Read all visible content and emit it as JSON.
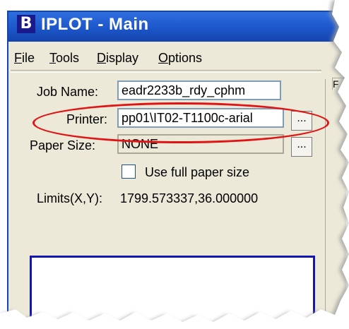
{
  "window": {
    "title": "IPLOT - Main",
    "app_icon": "bentley-b-icon"
  },
  "menu": [
    {
      "label": "File",
      "accel": "F",
      "rest": "ile"
    },
    {
      "label": "Tools",
      "accel": "T",
      "rest": "ools"
    },
    {
      "label": "Display",
      "accel": "D",
      "rest": "isplay"
    },
    {
      "label": "Options",
      "accel": "O",
      "rest": "ptions"
    }
  ],
  "form": {
    "job_name_label": "Job Name:",
    "job_name_value": "eadr2233b_rdy_cphm",
    "printer_label": "Printer:",
    "printer_value": "pp01\\IT02-T1100c-arial",
    "printer_browse": "...",
    "paper_size_label": "Paper Size:",
    "paper_size_value": "NONE",
    "paper_size_browse": "...",
    "use_full_paper_label": "Use full paper size",
    "use_full_paper_checked": false,
    "limits_label": "Limits(X,Y):",
    "limits_value": "1799.573337,36.000000"
  },
  "side_panel_fragment": "F",
  "colors": {
    "title_bar": "#1d56c9",
    "highlight": "#e01414",
    "preview_border": "#1515b0",
    "dialog_bg": "#ece9d8"
  }
}
